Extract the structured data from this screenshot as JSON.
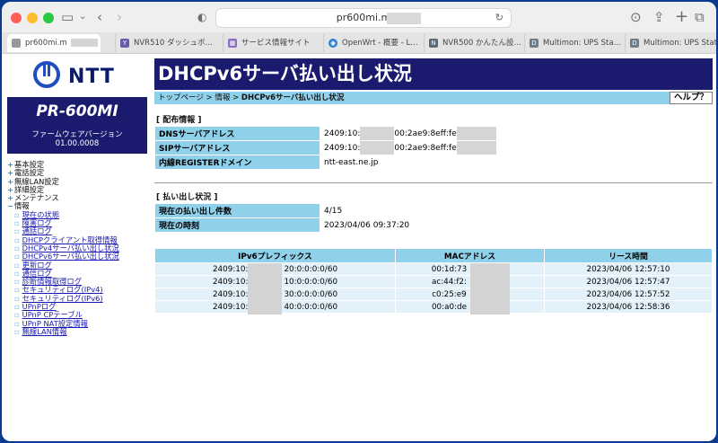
{
  "browser": {
    "url": "pr600mi.m",
    "tabs": [
      {
        "label": "pr600mi.m",
        "active": true
      },
      {
        "label": "NVR510 ダッシュボ…"
      },
      {
        "label": "サービス情報サイト"
      },
      {
        "label": "OpenWrt - 概要 - L…"
      },
      {
        "label": "NVR500 かんたん設…"
      },
      {
        "label": "Multimon: UPS Sta…"
      },
      {
        "label": "Multimon: UPS Stat…"
      }
    ]
  },
  "sidebar": {
    "logo": "NTT",
    "model": "PR-600MI",
    "firmware_label": "ファームウェアバージョン",
    "firmware_version": "01.00.0008",
    "menu": [
      {
        "label": "基本設定",
        "marker": "+"
      },
      {
        "label": "電話設定",
        "marker": "+"
      },
      {
        "label": "無線LAN設定",
        "marker": "+"
      },
      {
        "label": "詳細設定",
        "marker": "+"
      },
      {
        "label": "メンテナンス",
        "marker": "+"
      },
      {
        "label": "情報",
        "marker": "−"
      }
    ],
    "info_sub": [
      "現在の状態",
      "障害ログ",
      "通話ログ",
      "DHCPクライアント取得情報",
      "DHCPv4サーバ払い出し状況",
      "DHCPv6サーバ払い出し状況",
      "更新ログ",
      "通信ログ",
      "診断情報取得ログ",
      "セキュリティログ(IPv4)",
      "セキュリティログ(IPv6)",
      "UPnPログ",
      "UPnP CPテーブル",
      "UPnP NAT設定情報",
      "無線LAN情報"
    ]
  },
  "main": {
    "title": "DHCPv6サーバ払い出し状況",
    "breadcrumb_top": "トップページ",
    "breadcrumb_info": "情報",
    "breadcrumb_current": "DHCPv6サーバ払い出し状況",
    "sep": ">",
    "help": "ヘルプ？",
    "dist_title": "[ 配布情報 ]",
    "dist": {
      "dns_label": "DNSサーバアドレス",
      "dns_prefix": "2409:10:",
      "dns_suffix": "00:2ae9:8eff:fe",
      "sip_label": "SIPサーバアドレス",
      "sip_prefix": "2409:10:",
      "sip_suffix": "00:2ae9:8eff:fe",
      "domain_label": "内線REGISTERドメイン",
      "domain_value": "ntt-east.ne.jp"
    },
    "lease_title": "[ 払い出し状況 ]",
    "status": {
      "count_label": "現在の払い出し件数",
      "count_value": "4/15",
      "time_label": "現在の時刻",
      "time_value": "2023/04/06 09:37:20"
    },
    "lease_table": {
      "headers": [
        "IPv6プレフィックス",
        "MACアドレス",
        "リース時間"
      ],
      "rows": [
        [
          "2409:10:",
          "20:0:0:0:0/60",
          "00:1d:73",
          "2023/04/06 12:57:10"
        ],
        [
          "2409:10:",
          "10:0:0:0:0/60",
          "ac:44:f2:",
          "2023/04/06 12:57:47"
        ],
        [
          "2409:10:",
          "30:0:0:0:0/60",
          "c0:25:e9",
          "2023/04/06 12:57:52"
        ],
        [
          "2409:10:",
          "40:0:0:0:0/60",
          "00:a0:de",
          "2023/04/06 12:58:36"
        ]
      ]
    }
  }
}
